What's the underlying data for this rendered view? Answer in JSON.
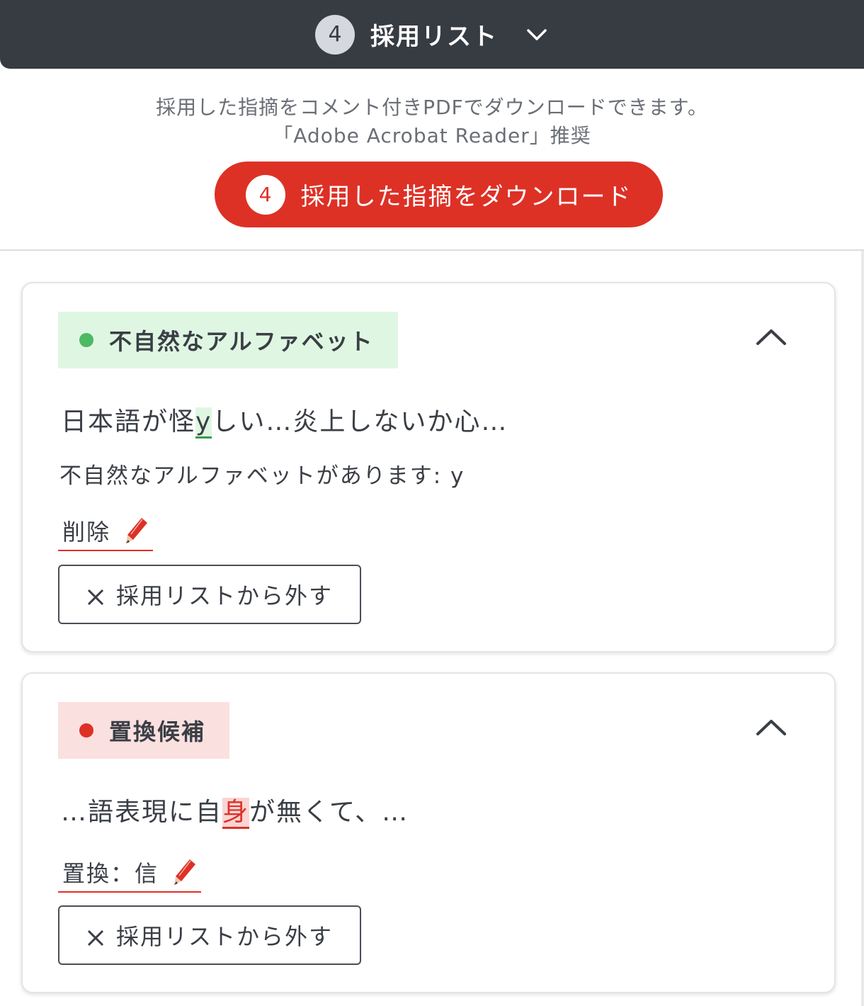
{
  "header": {
    "count": "4",
    "title": "採用リスト",
    "toggle_icon": "chevron-down-icon"
  },
  "info": {
    "line1": "採用した指摘をコメント付きPDFでダウンロードできます。",
    "line2": "「Adobe Acrobat Reader」推奨"
  },
  "download": {
    "count": "4",
    "label": "採用した指摘をダウンロード"
  },
  "cards": [
    {
      "tag": "不自然なアルファベット",
      "tag_color": "#4cb963",
      "excerpt_before": "日本語が怪",
      "excerpt_highlight": "y",
      "excerpt_after": "しい…炎上しないか心…",
      "message": "不自然なアルファベットがあります: y",
      "action": "削除",
      "remove_label": "採用リストから外す"
    },
    {
      "tag": "置換候補",
      "tag_color": "#dd3126",
      "excerpt_before": "…語表現に自",
      "excerpt_highlight": "身",
      "excerpt_after": "が無くて、…",
      "action": "置換：信",
      "remove_label": "採用リストから外す"
    }
  ],
  "colors": {
    "header_bg": "#373b42",
    "accent_red": "#dd3126",
    "accent_green": "#4cb963"
  }
}
